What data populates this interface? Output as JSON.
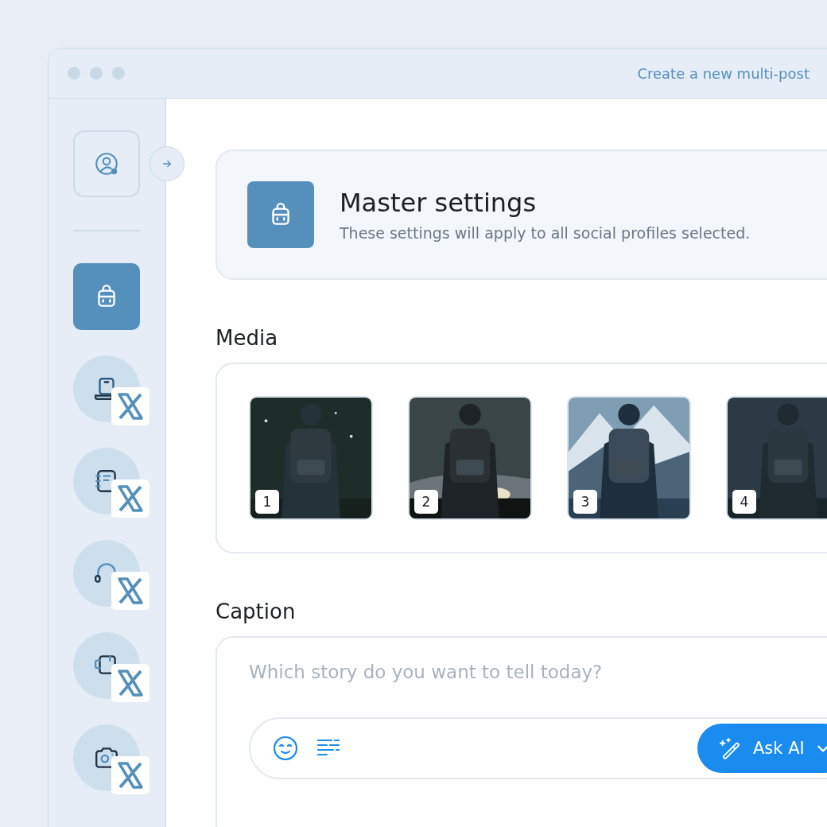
{
  "window": {
    "title": "Create a new multi-post"
  },
  "sidebar": {
    "items": [
      {
        "kind": "master",
        "selected": true
      },
      {
        "kind": "laptop",
        "x_badge": true,
        "selected": false
      },
      {
        "kind": "notebook",
        "x_badge": true,
        "selected": false
      },
      {
        "kind": "headset",
        "x_badge": true,
        "selected": false
      },
      {
        "kind": "mug",
        "x_badge": true,
        "selected": false
      },
      {
        "kind": "camera",
        "x_badge": true,
        "selected": false
      }
    ]
  },
  "master_settings": {
    "title": "Master settings",
    "subtitle": "These settings will apply to all social profiles selected."
  },
  "media": {
    "heading": "Media",
    "items": [
      {
        "number": "1",
        "kind": "picture"
      },
      {
        "number": "2",
        "kind": "picture"
      },
      {
        "number": "3",
        "kind": "picture"
      },
      {
        "number": "4",
        "kind": "picture"
      }
    ]
  },
  "caption": {
    "heading": "Caption",
    "placeholder": "Which story do you want to tell today?",
    "ask_ai": {
      "label": "Ask AI"
    }
  }
}
